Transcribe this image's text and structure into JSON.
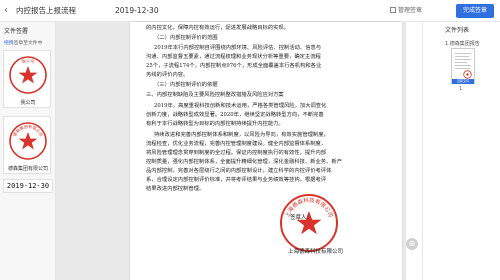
{
  "header": {
    "back_icon": "back-arrow-icon",
    "title": "内控报告上报流程",
    "date": "2019-12-30",
    "seal_manage_label": "管理签章",
    "confirm_label": "完成签章"
  },
  "left_panel": {
    "title": "文件签署",
    "subtitle_link": "拖拽",
    "subtitle_rest": "签章至文件中",
    "seals": [
      {
        "name": "我公司",
        "stamp_text": "我公司",
        "type": "round-seal"
      },
      {
        "name": "德森集团有限公司",
        "stamp_text": "德森集团有限公司",
        "type": "round-seal"
      }
    ],
    "date_stamp": "2019-12-30"
  },
  "document": {
    "paragraphs": [
      "的内控文化，保障内控有效运行，促进发展战略目标的实现。",
      "（二）内部控制评价的范围",
      "2019年本行内部控制自评围绕内部环境、风险评估、控制活动、信息与",
      "沟通、内部监督五要素，通过流程梳理和业务现状分析等重要，确定主流程",
      "25个，子流程174个，内部控制点976个，形成全面覆盖本行各机构和各业",
      "务线的评价内容。",
      "（三）内部控制评价的依据",
      "三、内部控制缺陷及主要风险控制整改措施及风险应对方案",
      "2019年，高度重视科技创新和技术运用，严格各类管理风险，加大调查化",
      "创新力度，战略转型成效显著。2020年，继续坚定战略转型方向，不断完善",
      "有利于本行战略转型为目标的内部控制持续提升内控能力。",
      "持续改进和完善内部控制体系和制度，以风险为导向，有效实施管理制度，",
      "流程检查，优化业务流程，完善内控管理制度建设。健全内部监督体系制度，",
      "将风险管理理念贯穿到制度的全过程。保证内控制度执行的有效性，提升内部",
      "控制质量，强化内部控制体系，全面提升精细化管理，深化金融科技、新业务、新产",
      "品内部控制，完善对各层级行之间的内部控制设计，建立科学的内控评价考评体",
      "系，合理设定内部控制评价标准，并将考评结果与业务绩效等挂钩，根据考评",
      "结果改进内部控制管理。"
    ],
    "signature_label": "签章人：",
    "company_stamp_text": "上海德森科技有限公司",
    "company_line": "上海德森科技有限公司"
  },
  "right_panel": {
    "title": "文件列表",
    "filename": "1.德森集团报告",
    "thumb_tag": "当前文件",
    "page_label": "1"
  },
  "colors": {
    "accent": "#2f6fde",
    "seal_red": "#d9342b"
  }
}
